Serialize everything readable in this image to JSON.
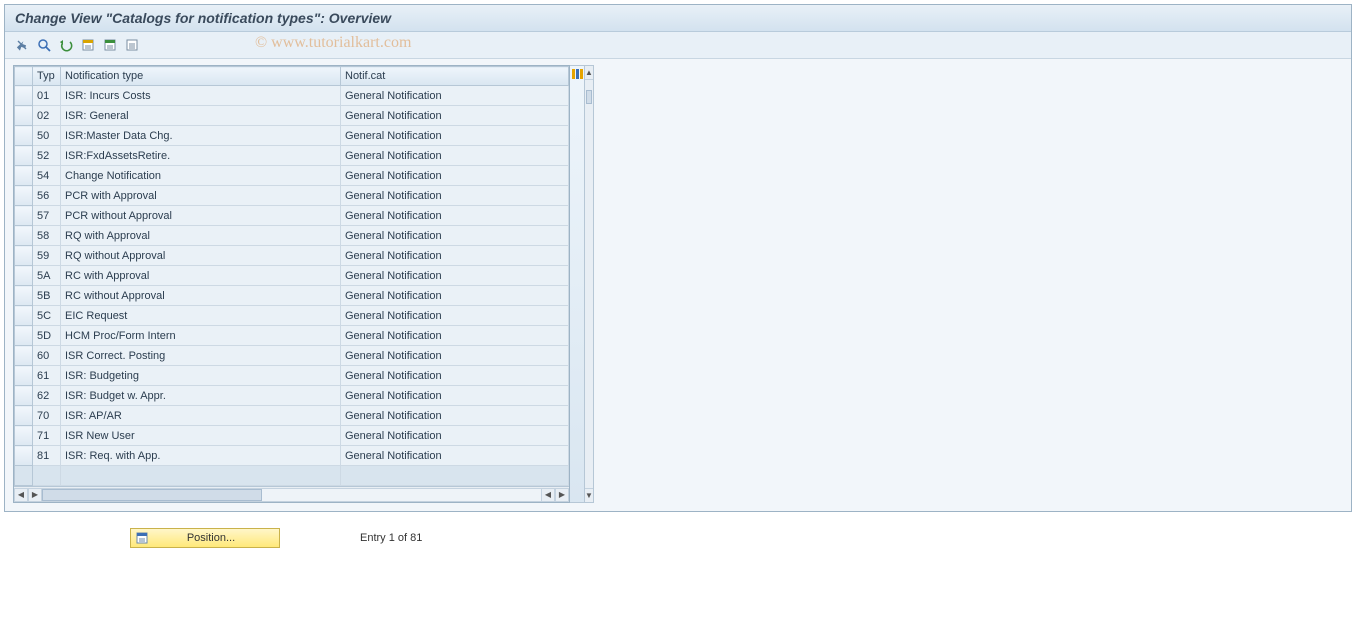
{
  "title": "Change View \"Catalogs for notification types\": Overview",
  "watermark": "© www.tutorialkart.com",
  "columns": {
    "sel": "",
    "typ": "Typ",
    "ntype": "Notification type",
    "cat": "Notif.cat"
  },
  "rows": [
    {
      "typ": "01",
      "ntype": "ISR: Incurs Costs",
      "cat": "General Notification"
    },
    {
      "typ": "02",
      "ntype": "ISR: General",
      "cat": "General Notification"
    },
    {
      "typ": "50",
      "ntype": "ISR:Master Data Chg.",
      "cat": "General Notification"
    },
    {
      "typ": "52",
      "ntype": "ISR:FxdAssetsRetire.",
      "cat": "General Notification"
    },
    {
      "typ": "54",
      "ntype": "Change Notification",
      "cat": "General Notification"
    },
    {
      "typ": "56",
      "ntype": "PCR with Approval",
      "cat": "General Notification"
    },
    {
      "typ": "57",
      "ntype": "PCR without Approval",
      "cat": "General Notification"
    },
    {
      "typ": "58",
      "ntype": "RQ with Approval",
      "cat": "General Notification"
    },
    {
      "typ": "59",
      "ntype": "RQ without Approval",
      "cat": "General Notification"
    },
    {
      "typ": "5A",
      "ntype": "RC with Approval",
      "cat": "General Notification"
    },
    {
      "typ": "5B",
      "ntype": "RC without Approval",
      "cat": "General Notification"
    },
    {
      "typ": "5C",
      "ntype": "EIC Request",
      "cat": "General Notification"
    },
    {
      "typ": "5D",
      "ntype": "HCM Proc/Form Intern",
      "cat": "General Notification"
    },
    {
      "typ": "60",
      "ntype": "ISR Correct. Posting",
      "cat": "General Notification"
    },
    {
      "typ": "61",
      "ntype": "ISR: Budgeting",
      "cat": "General Notification"
    },
    {
      "typ": "62",
      "ntype": "ISR: Budget w. Appr.",
      "cat": "General Notification"
    },
    {
      "typ": "70",
      "ntype": "ISR: AP/AR",
      "cat": "General Notification"
    },
    {
      "typ": "71",
      "ntype": "ISR New User",
      "cat": "General Notification"
    },
    {
      "typ": "81",
      "ntype": "ISR: Req. with App.",
      "cat": "General Notification"
    }
  ],
  "footer": {
    "position_label": "Position...",
    "entry_text": "Entry 1 of 81"
  }
}
